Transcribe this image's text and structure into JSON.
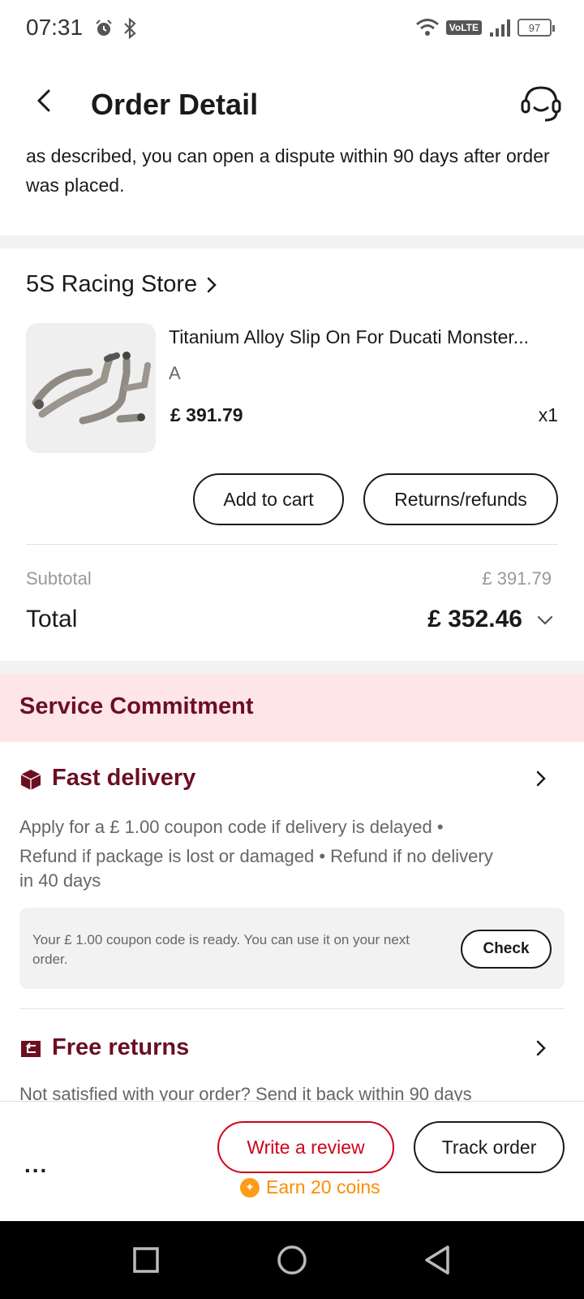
{
  "status_bar": {
    "time": "07:31",
    "network": "VoLTE",
    "battery": "97",
    "icons": [
      "alarm-icon",
      "bluetooth-icon",
      "wifi-icon",
      "signal-icon",
      "battery-icon"
    ]
  },
  "header": {
    "title": "Order Detail",
    "back_icon": "back-arrow-icon",
    "support_icon": "customer-service-icon"
  },
  "dispute_notice": "as described, you can open a dispute within 90 days after order was placed.",
  "store": {
    "name": "5S Racing Store",
    "product": {
      "title": "Titanium Alloy Slip On For Ducati Monster...",
      "variant": "A",
      "price": "£ 391.79",
      "quantity": "x1"
    },
    "actions": {
      "add_to_cart": "Add to cart",
      "returns": "Returns/refunds"
    },
    "subtotal_label": "Subtotal",
    "subtotal_value": "£ 391.79",
    "total_label": "Total",
    "total_value": "£ 352.46"
  },
  "service": {
    "title": "Service Commitment",
    "fast_delivery": {
      "title": "Fast delivery",
      "desc_line1": "Apply for a  £ 1.00 coupon code if delivery is delayed  •",
      "desc_line2": "Refund if package is lost or damaged  • Refund if no delivery",
      "desc_line3": "in 40 days"
    },
    "coupon": {
      "text": "Your  £ 1.00 coupon code is ready. You can use it on your next order.",
      "check_label": "Check"
    },
    "free_returns": {
      "title": "Free returns",
      "desc": "Not satisfied with your order? Send it back within 90 days"
    }
  },
  "bottom_bar": {
    "more": "...",
    "write_review": "Write a review",
    "track_order": "Track order",
    "coins": "Earn 20 coins"
  },
  "colors": {
    "brand_red": "#d0021b",
    "service_title": "#6b0f22",
    "service_banner_bg": "#fde5e8",
    "coin_orange": "#ff8c00"
  }
}
